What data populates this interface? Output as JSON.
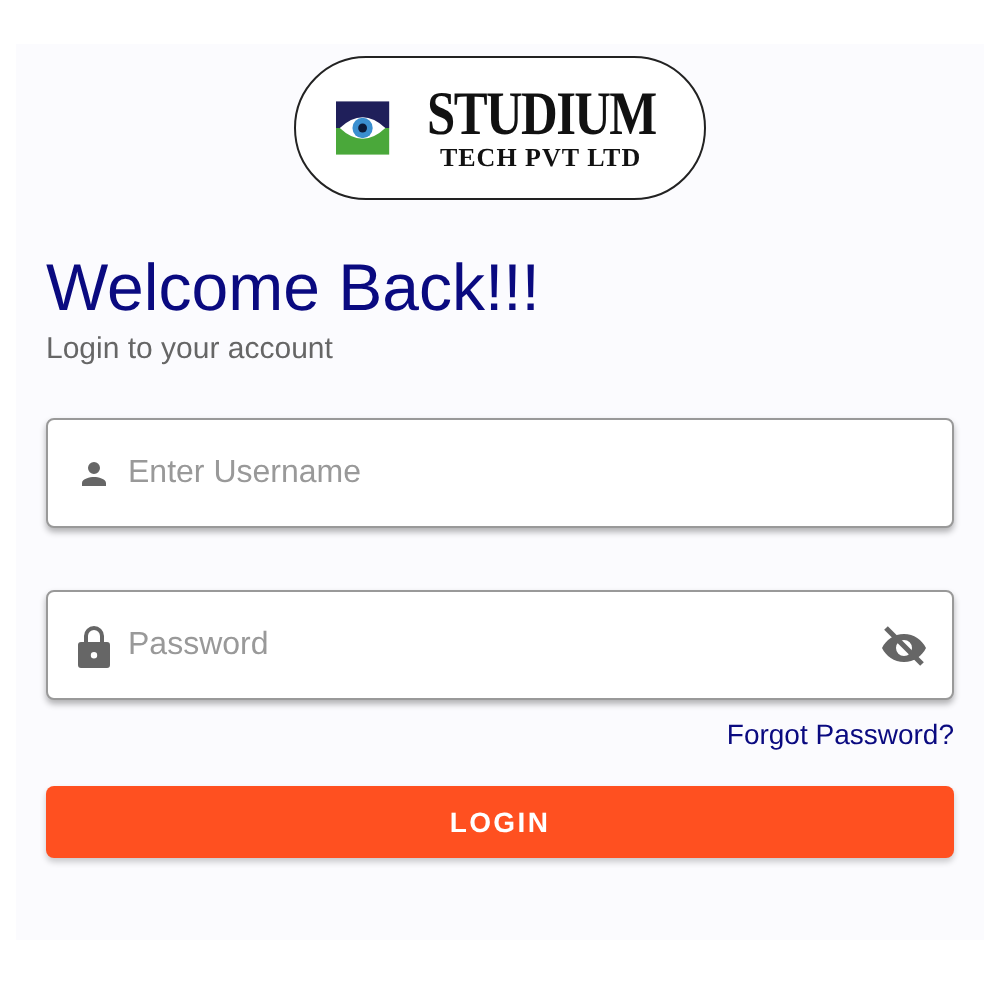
{
  "logo": {
    "name": "STUDIUM",
    "subtitle": "TECH PVT LTD"
  },
  "heading": "Welcome Back!!!",
  "subheading": "Login to your account",
  "fields": [
    {
      "kind": "username",
      "placeholder": "Enter Username"
    },
    {
      "kind": "password",
      "placeholder": "Password",
      "revealed": false
    }
  ],
  "forgot_link": "Forgot Password?",
  "login_button": "LOGIN"
}
